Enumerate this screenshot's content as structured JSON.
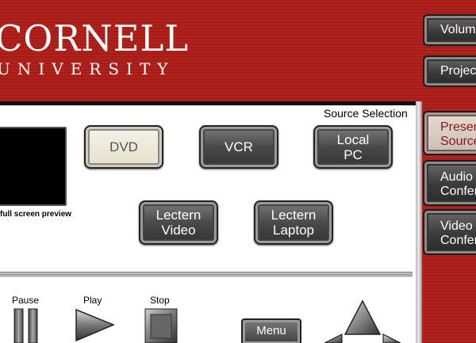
{
  "logo": {
    "line1": "CORNELL",
    "line2": "UNIVERSITY"
  },
  "nav": {
    "volume": "Volume",
    "projector": "Projector",
    "presentation": [
      "Presentation",
      "Source"
    ],
    "audio": [
      "Audio",
      "Conference"
    ],
    "video": [
      "Video",
      "Conference"
    ]
  },
  "source": {
    "title": "Source Selection",
    "preview_label": "full screen preview",
    "dvd": [
      "DVD"
    ],
    "vcr": [
      "VCR"
    ],
    "local_pc": [
      "Local",
      "PC"
    ],
    "lectern_video": [
      "Lectern",
      "Video"
    ],
    "lectern_laptop": [
      "Lectern",
      "Laptop"
    ],
    "selected": "DVD"
  },
  "transport": {
    "pause": "Pause",
    "play": "Play",
    "stop": "Stop",
    "menu": "Menu"
  },
  "colors": {
    "brand_red": "#b3231e",
    "panel": "#ffffff",
    "button_dark": "#4a4a4a",
    "button_selected": "#f6f3e8"
  }
}
